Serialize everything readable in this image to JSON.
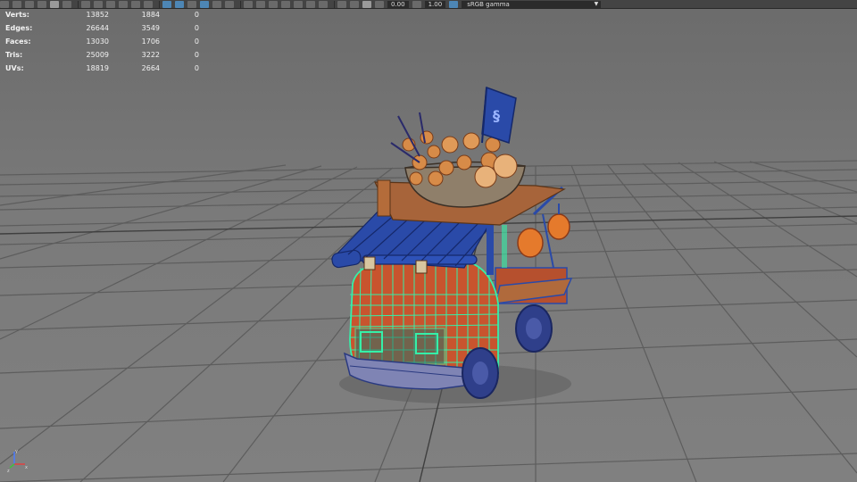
{
  "toolbar": {
    "exposure_value": "0.00",
    "gamma_value": "1.00",
    "color_space": "sRGB gamma"
  },
  "hud": {
    "rows": [
      {
        "label": "Verts:",
        "values": [
          "13852",
          "1884",
          "0"
        ]
      },
      {
        "label": "Edges:",
        "values": [
          "26644",
          "3549",
          "0"
        ]
      },
      {
        "label": "Faces:",
        "values": [
          "13030",
          "1706",
          "0"
        ]
      },
      {
        "label": "Tris:",
        "values": [
          "25009",
          "3222",
          "0"
        ]
      },
      {
        "label": "UVs:",
        "values": [
          "18819",
          "2664",
          "0"
        ]
      }
    ]
  },
  "axis": {
    "x": "x",
    "y": "y",
    "z": "z"
  },
  "colors": {
    "viewport_bg": "#787878",
    "grid_line": "#5e5e5e",
    "grid_axis": "#3f3f3f",
    "wire_selected": "#35f0a8",
    "wire_blue": "#2a4aa8",
    "truck_orange": "#c8542e",
    "lantern_orange": "#e57a2c"
  }
}
